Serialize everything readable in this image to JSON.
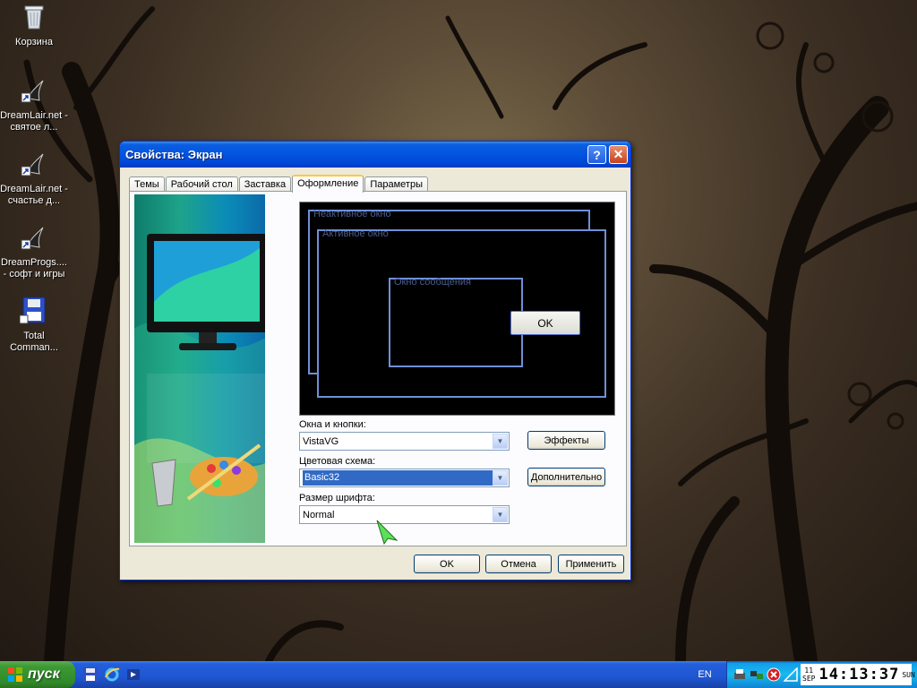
{
  "desktop": {
    "icons": [
      {
        "label": "Корзина",
        "icon": "recycle-bin-icon"
      },
      {
        "label": "DreamLair.net - святое л...",
        "icon": "shortcut-icon"
      },
      {
        "label": "DreamLair.net - счастье д...",
        "icon": "shortcut-icon"
      },
      {
        "label": "DreamProgs.... - софт и игры",
        "icon": "shortcut-icon"
      },
      {
        "label": "Total Comman...",
        "icon": "floppy-icon"
      }
    ]
  },
  "dialog": {
    "title": "Свойства: Экран",
    "help_button": "?",
    "close_button": "✕",
    "tabs": [
      "Темы",
      "Рабочий стол",
      "Заставка",
      "Оформление",
      "Параметры"
    ],
    "active_tab": "Оформление",
    "preview": {
      "inactive_caption": "Неактивное окно",
      "active_caption": "Активное окно",
      "message_caption": "Окно сообщения",
      "ok_label": "OK"
    },
    "windows_buttons_label": "Окна и кнопки:",
    "windows_buttons_value": "VistaVG",
    "color_scheme_label": "Цветовая схема:",
    "color_scheme_value": "Basic32",
    "font_size_label": "Размер шрифта:",
    "font_size_value": "Normal",
    "effects_button": "Эффекты",
    "advanced_button": "Дополнительно",
    "ok_button": "OK",
    "cancel_button": "Отмена",
    "apply_button": "Применить"
  },
  "taskbar": {
    "start_label": "пуск",
    "language": "EN",
    "clock": {
      "day": "11",
      "month": "SEP",
      "time": "14:13:37",
      "weekday": "SUN"
    }
  },
  "colors": {
    "titlebar": "#0254e0",
    "dialog_bg": "#ece9d8",
    "selection": "#316ac5",
    "taskbar": "#245edb",
    "start_green": "#3c9a33"
  }
}
